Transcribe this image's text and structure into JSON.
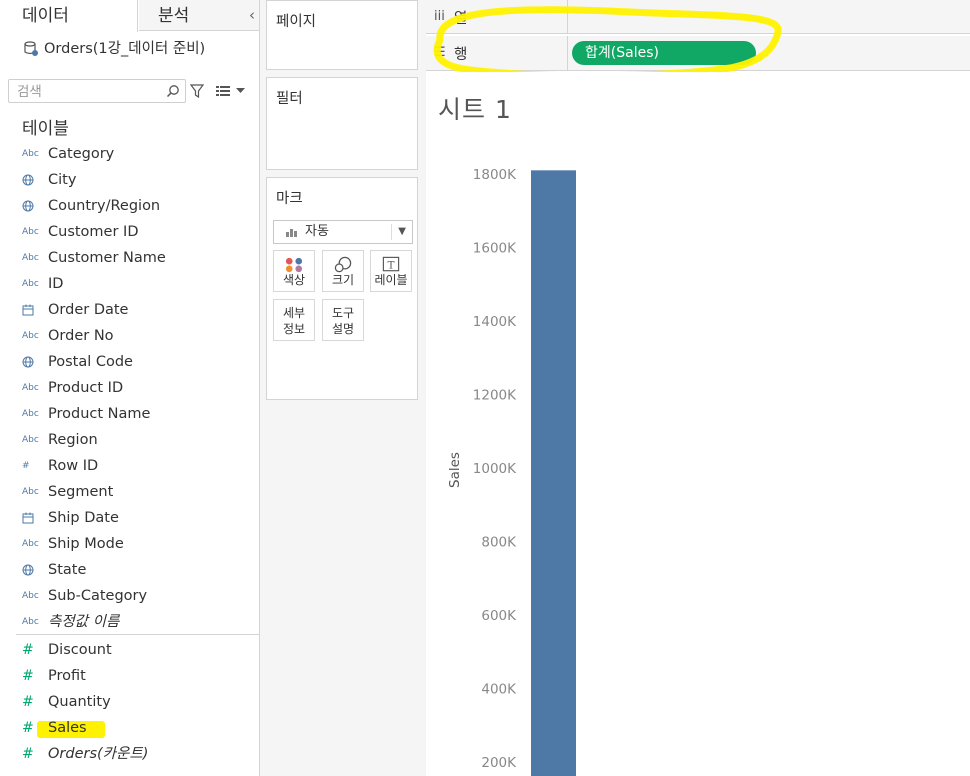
{
  "left_pane": {
    "tabs": {
      "data": "데이터",
      "analysis": "분석"
    },
    "datasource": "Orders(1강_데이터 준비)",
    "search": {
      "placeholder": "검색"
    },
    "section_title": "테이블",
    "dimensions": [
      {
        "icon": "Abc",
        "name": "Category"
      },
      {
        "icon": "globe",
        "name": "City"
      },
      {
        "icon": "globe",
        "name": "Country/Region"
      },
      {
        "icon": "Abc",
        "name": "Customer ID"
      },
      {
        "icon": "Abc",
        "name": "Customer Name"
      },
      {
        "icon": "Abc",
        "name": "ID"
      },
      {
        "icon": "calendar",
        "name": "Order Date"
      },
      {
        "icon": "Abc",
        "name": "Order No"
      },
      {
        "icon": "globe",
        "name": "Postal Code"
      },
      {
        "icon": "Abc",
        "name": "Product ID"
      },
      {
        "icon": "Abc",
        "name": "Product Name"
      },
      {
        "icon": "Abc",
        "name": "Region"
      },
      {
        "icon": "#",
        "name": "Row ID"
      },
      {
        "icon": "Abc",
        "name": "Segment"
      },
      {
        "icon": "calendar",
        "name": "Ship Date"
      },
      {
        "icon": "Abc",
        "name": "Ship Mode"
      },
      {
        "icon": "globe",
        "name": "State"
      },
      {
        "icon": "Abc",
        "name": "Sub-Category"
      },
      {
        "icon": "Abc",
        "name": "측정값 이름",
        "italic": true
      }
    ],
    "measures": [
      {
        "icon": "#",
        "name": "Discount"
      },
      {
        "icon": "#",
        "name": "Profit"
      },
      {
        "icon": "#",
        "name": "Quantity"
      },
      {
        "icon": "#",
        "name": "Sales"
      },
      {
        "icon": "#",
        "name": "Orders(카운트)",
        "italic": true
      }
    ]
  },
  "cards": {
    "pages": "페이지",
    "filters": "필터",
    "marks": {
      "title": "마크",
      "type": "자동",
      "buttons": [
        "색상",
        "크기",
        "레이블",
        "세부\n정보",
        "도구\n설명"
      ]
    }
  },
  "shelves": {
    "columns": {
      "icon": "iii",
      "label": "열"
    },
    "rows": {
      "icon": "☰",
      "label": "행",
      "pill": "합계(Sales)"
    }
  },
  "sheet": {
    "title": "시트 1"
  },
  "colors": {
    "accent_pill": "#11a865",
    "bar": "#4e79a7",
    "highlight": "#fff200"
  },
  "chart_data": {
    "type": "bar",
    "categories": [
      ""
    ],
    "values": [
      1810000
    ],
    "ylabel": "Sales",
    "yticks": [
      "200K",
      "400K",
      "600K",
      "800K",
      "1000K",
      "1200K",
      "1400K",
      "1600K",
      "1800K"
    ],
    "ylim": [
      0,
      1900000
    ],
    "grid": false
  }
}
